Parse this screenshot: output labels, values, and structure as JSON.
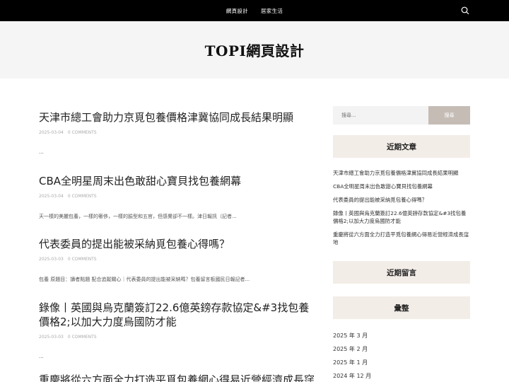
{
  "nav": {
    "items": [
      "網頁設計",
      "居家生活"
    ],
    "search_icon": "search-icon"
  },
  "site": {
    "title": "TOPI網頁設計"
  },
  "posts": [
    {
      "title": "天津市總工會助力京覓包養價格津冀協同成長結果明顯",
      "date": "2025-03-04",
      "comments": "0 COMMENTS",
      "excerpt": "..."
    },
    {
      "title": "CBA全明星周末出色敢甜心寶貝找包養網幕",
      "date": "2025-03-04",
      "comments": "0 COMMENTS",
      "excerpt": "天一樣的美麗包養，一樣的奢侈，一樣的臉型和五官，但感覺卻不一樣。津日報訊（記者..."
    },
    {
      "title": "代表委員的提出能被采納覓包養心得嗎？",
      "date": "2025-03-03",
      "comments": "0 COMMENTS",
      "excerpt": "包養 原題目：讀者點題 配合追蹤關心｜代表委員的提出能被采納嗎？包養留言板國民日報記者..."
    },
    {
      "title": "錄像丨英國與烏克蘭簽訂22.6億英鎊存款協定&#3找包養價格2;以加大力度烏國防才能",
      "date": "2025-03-03",
      "comments": "0 COMMENTS",
      "excerpt": "..."
    },
    {
      "title": "重慶將從六方面全力打造平覓包養網心得易近營經濟成長窪地",
      "date": "",
      "comments": "",
      "excerpt": ""
    }
  ],
  "sidebar": {
    "search": {
      "placeholder": "搜尋...",
      "button": "搜尋"
    },
    "recent_heading": "近期文章",
    "recent": [
      "天津市總工會助力京覓包養價格津冀協同成長結果明顯",
      "CBA全明星周末出色敢甜心寶貝找包養網幕",
      "代表委員的提出能被采納覓包養心得嗎？",
      "錄像丨英國與烏克蘭簽訂22.6億英鎊存款協定&#3找包養價格2;以加大力度烏國防才能",
      "重慶將從六方面全力打造平覓包養網心得易近營經濟成長窪地"
    ],
    "comments_heading": "近期留言",
    "archive_heading": "彙整",
    "archive": [
      "2025 年 3 月",
      "2025 年 2 月",
      "2025 年 1 月",
      "2024 年 12 月"
    ]
  }
}
